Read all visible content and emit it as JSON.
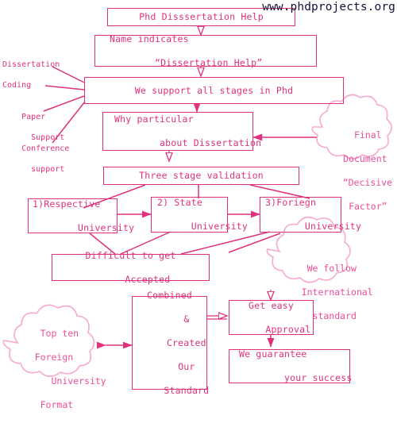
{
  "watermark": "www.phdprojects.org",
  "colors": {
    "accent": "#e0317c",
    "cloud_text": "#ee4e96",
    "cloud_outline": "#f7a9cf",
    "watermark": "#12123a",
    "background": "#ffffff"
  },
  "boxes": {
    "title": "Phd Disssertation Help",
    "name_indicates_line1": "Name indicates",
    "name_indicates_line2": "  “Dissertation Help”",
    "support_all_stages": "We support all stages in Phd",
    "why_particular_line1": "Why particular",
    "why_particular_line2": "  about Dissertation",
    "three_stage": "Three stage validation",
    "respective_line1": "1)Respective",
    "respective_line2": "  University",
    "state_line1": "2) State",
    "state_line2": "University",
    "foriegn_line1": "3)Foriegn",
    "foriegn_line2": " University",
    "difficult_line1": "Difficult to get",
    "difficult_line2": "Accepted",
    "combined_line1": "Combined",
    "combined_line2": "&",
    "combined_line3": "Created",
    "combined_line4": "Our",
    "combined_line5": "Standard",
    "approval_line1": "Get easy",
    "approval_line2": "Approval",
    "guarantee_line1": "We guarantee",
    "guarantee_line2": "  your success"
  },
  "side_labels": {
    "dissertation": "Dissertation",
    "coding": "Coding",
    "paper_support_line1": "Paper",
    "paper_support_line2": "  Support",
    "conference_line1": "Conference",
    "conference_line2": "  support"
  },
  "clouds": {
    "final_document_line1": " Final",
    "final_document_line2": "Document",
    "final_document_line3": "“Decisive",
    "final_document_line4": " Factor”",
    "international_line1": " We follow",
    "international_line2": "International",
    "international_line3": "  standard",
    "top_ten_line1": " Top ten",
    "top_ten_line2": "Foreign",
    "top_ten_line3": "   University",
    "top_ten_line4": " Format"
  }
}
